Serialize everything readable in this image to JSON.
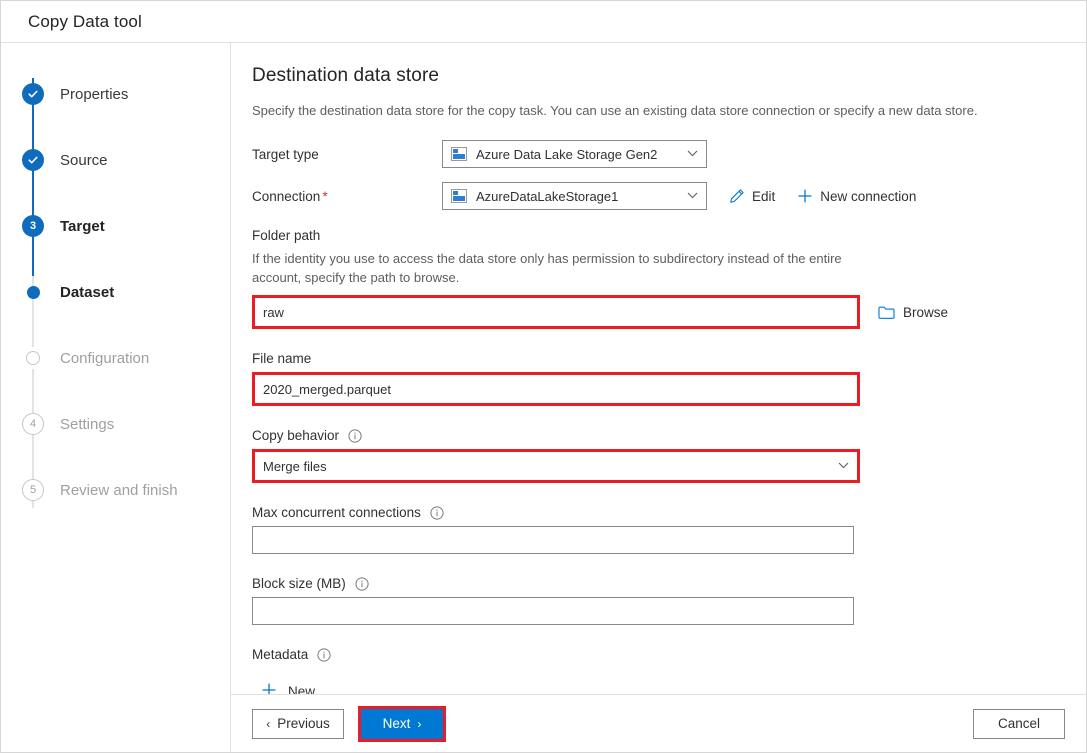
{
  "window": {
    "title": "Copy Data tool"
  },
  "sidebar": {
    "steps": [
      {
        "label": "Properties",
        "marker": "check",
        "state": "done"
      },
      {
        "label": "Source",
        "marker": "check",
        "state": "done"
      },
      {
        "label": "Target",
        "marker": "3",
        "state": "current"
      },
      {
        "label": "Dataset",
        "marker": "",
        "state": "active-dot"
      },
      {
        "label": "Configuration",
        "marker": "",
        "state": "pending-empty"
      },
      {
        "label": "Settings",
        "marker": "4",
        "state": "pending"
      },
      {
        "label": "Review and finish",
        "marker": "5",
        "state": "pending"
      }
    ]
  },
  "main": {
    "title": "Destination data store",
    "description": "Specify the destination data store for the copy task. You can use an existing data store connection or specify a new data store.",
    "target_type": {
      "label": "Target type",
      "value": "Azure Data Lake Storage Gen2"
    },
    "connection": {
      "label": "Connection",
      "required_mark": "*",
      "value": "AzureDataLakeStorage1",
      "edit_label": "Edit",
      "new_connection_label": "New connection"
    },
    "folder_path": {
      "label": "Folder path",
      "helper": "If the identity you use to access the data store only has permission to subdirectory instead of the entire account, specify the path to browse.",
      "value": "raw",
      "browse_label": "Browse"
    },
    "file_name": {
      "label": "File name",
      "value": "2020_merged.parquet"
    },
    "copy_behavior": {
      "label": "Copy behavior",
      "value": "Merge files"
    },
    "max_concurrent_connections": {
      "label": "Max concurrent connections",
      "value": ""
    },
    "block_size": {
      "label": "Block size (MB)",
      "value": ""
    },
    "metadata": {
      "label": "Metadata",
      "new_label": "New"
    }
  },
  "footer": {
    "previous_label": "Previous",
    "next_label": "Next",
    "cancel_label": "Cancel",
    "prev_arrow": "‹",
    "next_arrow": "›"
  },
  "colors": {
    "accent": "#0078d4",
    "step_blue": "#0f6cbd",
    "highlight_red": "#ec1c24",
    "required_red": "#d13438",
    "border_gray": "#8a8886"
  }
}
